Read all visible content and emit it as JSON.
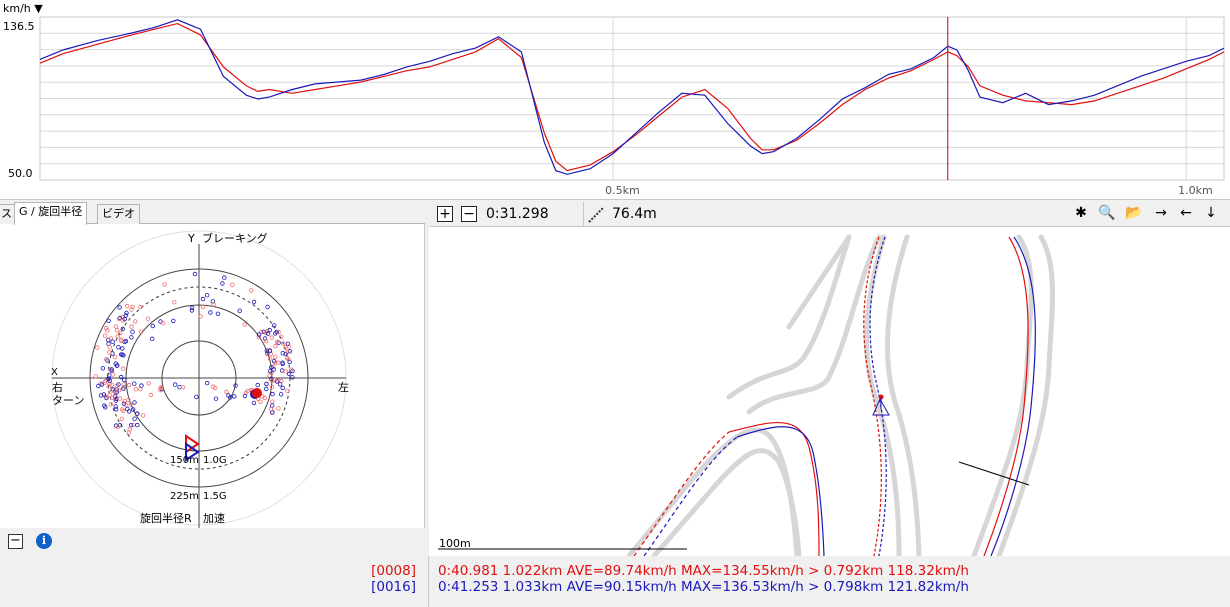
{
  "colors": {
    "red": "#e01010",
    "blue": "#1a1ab8",
    "grid": "#d8d8d8",
    "cursor": "#c00000",
    "track": "#d6d6d6"
  },
  "speed_chart": {
    "unit_label": "km/h ▼",
    "y_max_label": "136.5",
    "y_min_label": "50.0",
    "x_tick_labels": [
      "0.5km",
      "1.0km"
    ],
    "chart_data": {
      "type": "line",
      "xlabel": "",
      "ylabel": "km/h",
      "ylim": [
        50.0,
        136.5
      ],
      "xlim": [
        0,
        1.033
      ],
      "cursor_x": 0.792,
      "series": [
        {
          "color": "#e01010",
          "x": [
            0,
            0.02,
            0.05,
            0.08,
            0.1,
            0.12,
            0.14,
            0.16,
            0.18,
            0.19,
            0.2,
            0.22,
            0.24,
            0.26,
            0.28,
            0.3,
            0.32,
            0.34,
            0.36,
            0.38,
            0.4,
            0.42,
            0.44,
            0.45,
            0.46,
            0.48,
            0.5,
            0.52,
            0.54,
            0.56,
            0.58,
            0.6,
            0.62,
            0.63,
            0.64,
            0.66,
            0.68,
            0.7,
            0.72,
            0.74,
            0.76,
            0.78,
            0.792,
            0.8,
            0.81,
            0.82,
            0.84,
            0.86,
            0.88,
            0.9,
            0.92,
            0.94,
            0.96,
            0.98,
            1.0,
            1.02,
            1.033
          ],
          "y": [
            112,
            117,
            122,
            127,
            130,
            133,
            127,
            110,
            100,
            97,
            98,
            96,
            98,
            100,
            102,
            105,
            108,
            110,
            114,
            118,
            125,
            115,
            75,
            60,
            55,
            58,
            65,
            74,
            84,
            94,
            98,
            88,
            72,
            66,
            66,
            71,
            80,
            90,
            98,
            104,
            108,
            114,
            118,
            116,
            110,
            100,
            95,
            92,
            91,
            90,
            92,
            96,
            100,
            104,
            109,
            114,
            118
          ]
        },
        {
          "color": "#1a1ab8",
          "x": [
            0,
            0.02,
            0.05,
            0.08,
            0.1,
            0.12,
            0.14,
            0.16,
            0.18,
            0.19,
            0.2,
            0.22,
            0.24,
            0.26,
            0.28,
            0.3,
            0.32,
            0.34,
            0.36,
            0.38,
            0.4,
            0.42,
            0.44,
            0.45,
            0.46,
            0.48,
            0.5,
            0.52,
            0.54,
            0.56,
            0.58,
            0.6,
            0.62,
            0.63,
            0.64,
            0.66,
            0.68,
            0.7,
            0.72,
            0.74,
            0.76,
            0.78,
            0.792,
            0.8,
            0.81,
            0.82,
            0.84,
            0.86,
            0.88,
            0.9,
            0.92,
            0.94,
            0.96,
            0.98,
            1.0,
            1.02,
            1.033
          ],
          "y": [
            114,
            119,
            124,
            128,
            131,
            135,
            130,
            105,
            95,
            93,
            94,
            98,
            101,
            102,
            103,
            106,
            110,
            113,
            117,
            120,
            126,
            118,
            70,
            55,
            53,
            56,
            64,
            75,
            86,
            96,
            95,
            80,
            68,
            64,
            65,
            72,
            82,
            93,
            99,
            106,
            109,
            115,
            121,
            119,
            108,
            94,
            91,
            96,
            90,
            92,
            95,
            100,
            105,
            109,
            113,
            116,
            120
          ]
        }
      ]
    }
  },
  "g_panel": {
    "tabs": [
      "ス",
      "G / 旋回半径",
      "ビデオ"
    ],
    "y_axis_label": "Y",
    "braking_label": "ブレーキング",
    "x_axis_label": "X",
    "right_label": "右",
    "turn_label": "ターン",
    "left_label": "左",
    "radius_150": "150m",
    "g_10": "1.0G",
    "radius_225": "225m",
    "g_15": "1.5G",
    "turn_radius_label": "旋回半径R",
    "accel_label": "加速",
    "footer_minus": "−",
    "footer_info": "i"
  },
  "map_panel": {
    "plus_btn": "+",
    "minus_btn": "−",
    "time": "0:31.298",
    "distance": "76.4m",
    "scale_label": "100m",
    "tool_icons": [
      "✱",
      "🔍",
      "📂",
      "→",
      "←",
      "↓"
    ]
  },
  "bottom": {
    "lap1_id": "[0008]",
    "lap1_info": "0:40.981 1.022km AVE=89.74km/h MAX=134.55km/h > 0.792km 118.32km/h",
    "lap2_id": "[0016]",
    "lap2_info": "0:41.253 1.033km AVE=90.15km/h MAX=136.53km/h > 0.798km 121.82km/h"
  }
}
